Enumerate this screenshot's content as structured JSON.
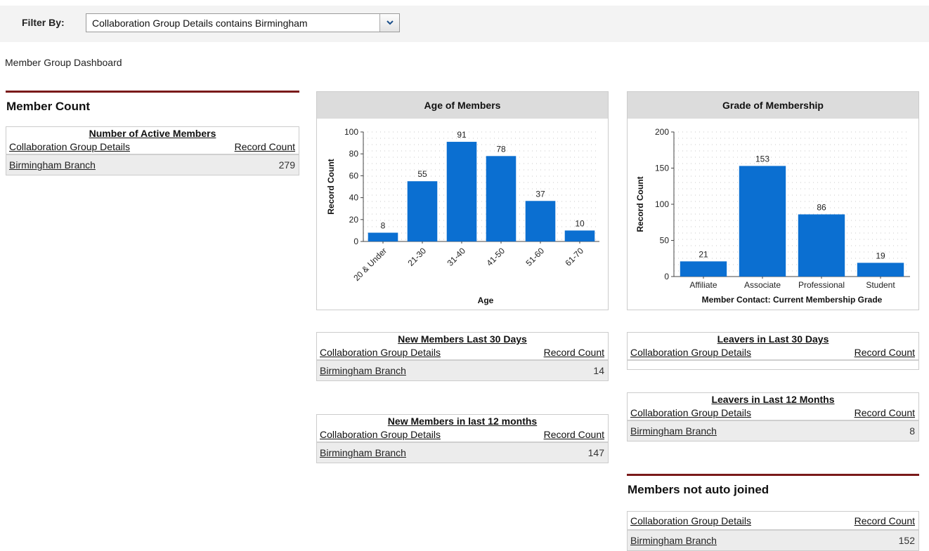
{
  "filter": {
    "label": "Filter By:",
    "value": "Collaboration Group Details contains Birmingham"
  },
  "dashboard_title": "Member Group Dashboard",
  "member_count": {
    "heading": "Member Count",
    "table": {
      "title": "Number of Active Members",
      "col1": "Collaboration Group Details",
      "col2": "Record Count",
      "rows": [
        {
          "name": "Birmingham Branch",
          "count": "279"
        }
      ]
    }
  },
  "new_30": {
    "title": "New Members Last 30 Days",
    "col1": "Collaboration Group Details",
    "col2": "Record Count",
    "rows": [
      {
        "name": "Birmingham Branch",
        "count": "14"
      }
    ]
  },
  "new_12": {
    "title": "New Members in last 12 months",
    "col1": "Collaboration Group Details",
    "col2": "Record Count",
    "rows": [
      {
        "name": "Birmingham Branch",
        "count": "147"
      }
    ]
  },
  "leavers_30": {
    "title": "Leavers in Last 30 Days",
    "col1": "Collaboration Group Details",
    "col2": "Record Count"
  },
  "leavers_12": {
    "title": "Leavers in Last 12 Months",
    "col1": "Collaboration Group Details",
    "col2": "Record Count",
    "rows": [
      {
        "name": "Birmingham Branch",
        "count": "8"
      }
    ]
  },
  "not_auto": {
    "heading": "Members not auto joined",
    "col1": "Collaboration Group Details",
    "col2": "Record Count",
    "rows": [
      {
        "name": "Birmingham Branch",
        "count": "152"
      }
    ]
  },
  "colors": {
    "bar": "#0b6fd1",
    "section_rule": "#7a1a1a"
  },
  "chart_data": [
    {
      "type": "bar",
      "title": "Age of Members",
      "xlabel": "Age",
      "ylabel": "Record Count",
      "categories": [
        "20 & Under",
        "21-30",
        "31-40",
        "41-50",
        "51-60",
        "61-70"
      ],
      "values": [
        8,
        55,
        91,
        78,
        37,
        10
      ],
      "ylim": [
        0,
        100
      ],
      "yticks": [
        0,
        20,
        40,
        60,
        80,
        100
      ],
      "grid": true
    },
    {
      "type": "bar",
      "title": "Grade of Membership",
      "xlabel": "Member Contact: Current Membership Grade",
      "ylabel": "Record Count",
      "categories": [
        "Affiliate",
        "Associate",
        "Professional",
        "Student"
      ],
      "values": [
        21,
        153,
        86,
        19
      ],
      "ylim": [
        0,
        200
      ],
      "yticks": [
        0,
        50,
        100,
        150,
        200
      ],
      "grid": true
    }
  ]
}
